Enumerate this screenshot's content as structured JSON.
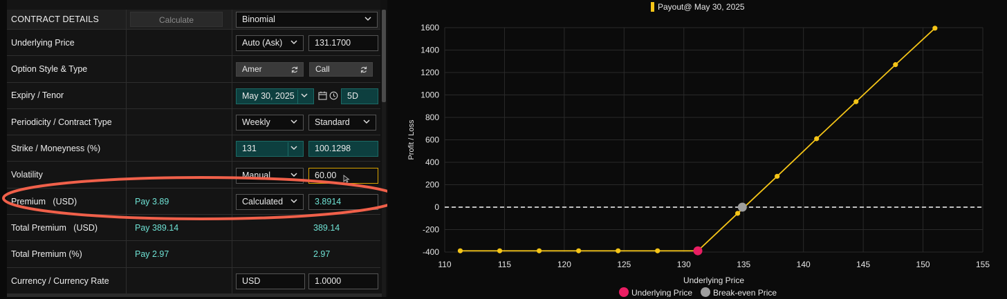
{
  "left": {
    "header_title": "CONTRACT DETAILS",
    "calculate_label": "Calculate",
    "pricing_model": "Binomial",
    "rows": [
      {
        "label": "Underlying Price"
      },
      {
        "label": "Option Style & Type"
      },
      {
        "label": "Expiry / Tenor"
      },
      {
        "label": "Periodicity / Contract Type"
      },
      {
        "label": "Strike / Moneyness (%)"
      },
      {
        "label": "Volatility"
      },
      {
        "label": "Premium   (USD)",
        "pay": "Pay 3.89"
      },
      {
        "label": "Total Premium   (USD)",
        "pay": "Pay 389.14"
      },
      {
        "label": "Total Premium (%)",
        "pay": "Pay 2.97"
      },
      {
        "label": "Currency / Currency Rate"
      }
    ],
    "underlying_source": "Auto (Ask)",
    "underlying_price": "131.1700",
    "option_style": "Amer",
    "option_type": "Call",
    "expiry": "May 30, 2025",
    "tenor": "5D",
    "periodicity": "Weekly",
    "contract_type": "Standard",
    "strike": "131",
    "moneyness": "100.1298",
    "volatility_mode": "Manual",
    "volatility": "60.00",
    "premium_mode": "Calculated",
    "premium_value": "3.8914",
    "total_premium_value": "389.14",
    "total_premium_pct_value": "2.97",
    "currency": "USD",
    "currency_rate": "1.0000"
  },
  "colors": {
    "teal_text": "#6fe3d5",
    "teal_field": "#0d3f3f",
    "series": "#f5c518",
    "underlying_marker": "#e91e63",
    "breakeven_marker": "#9e9e9e",
    "annotation": "#f0604a"
  },
  "chart_data": {
    "type": "line",
    "legend_top": "Payout@ May 30, 2025",
    "xlabel": "Underlying Price",
    "ylabel": "Profit / Loss",
    "xlim": [
      110,
      155
    ],
    "ylim": [
      -400,
      1600
    ],
    "xticks": [
      110,
      115,
      120,
      125,
      130,
      135,
      140,
      145,
      150,
      155
    ],
    "yticks": [
      -400,
      -200,
      0,
      200,
      400,
      600,
      800,
      1000,
      1200,
      1400,
      1600
    ],
    "points": [
      [
        111.3,
        -389
      ],
      [
        114.6,
        -389
      ],
      [
        117.9,
        -389
      ],
      [
        121.2,
        -389
      ],
      [
        124.5,
        -389
      ],
      [
        127.8,
        -389
      ],
      [
        131.17,
        -389
      ],
      [
        134.5,
        -55
      ],
      [
        137.8,
        275
      ],
      [
        141.1,
        610
      ],
      [
        144.4,
        940
      ],
      [
        147.7,
        1270
      ],
      [
        151.0,
        1595
      ]
    ],
    "underlying_price": [
      131.17,
      -389
    ],
    "breakeven": [
      134.89,
      0
    ],
    "legend_bottom": [
      "Underlying Price",
      "Break-even Price"
    ]
  }
}
